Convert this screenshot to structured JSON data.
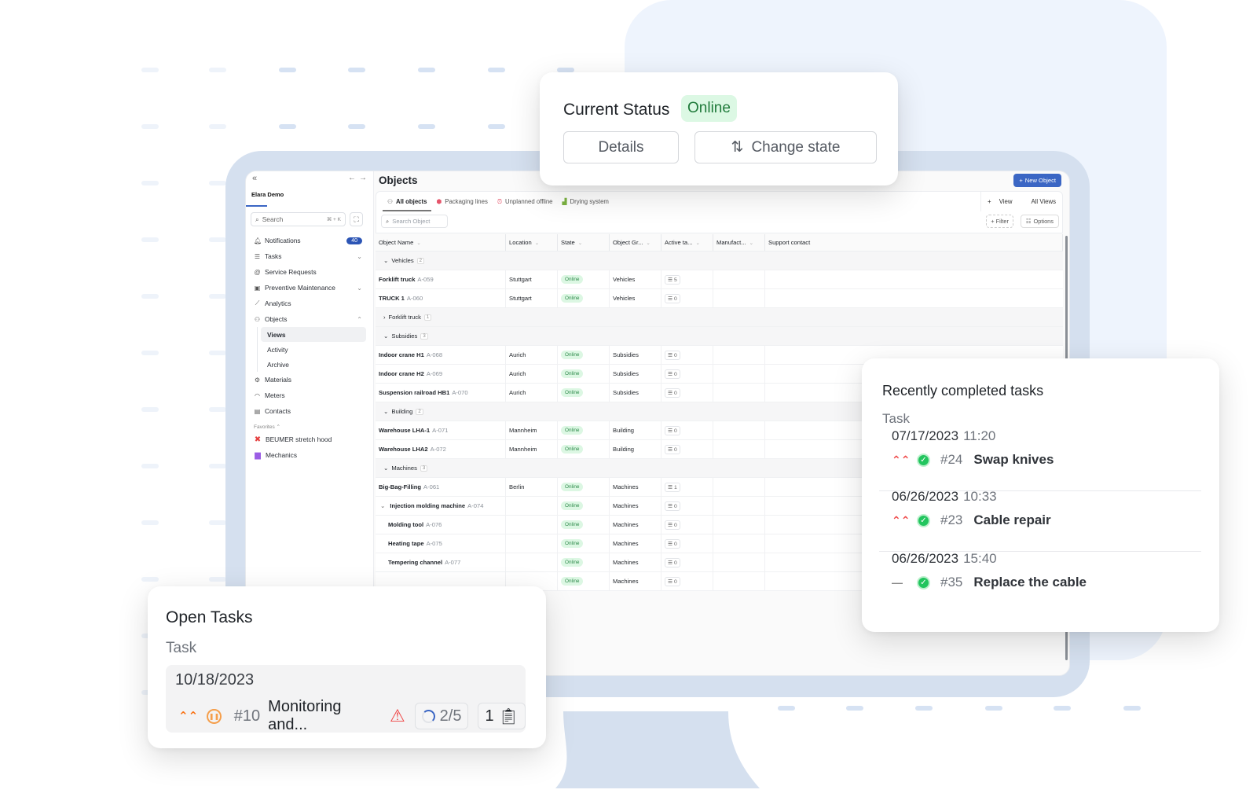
{
  "sidebar": {
    "workspace": "Elara Demo",
    "search_placeholder": "Search",
    "search_shortcut": "⌘ + K",
    "items": [
      {
        "label": "Notifications",
        "icon": "bell-icon",
        "badge": "40"
      },
      {
        "label": "Tasks",
        "icon": "tasks-icon"
      },
      {
        "label": "Service Requests",
        "icon": "at-icon"
      },
      {
        "label": "Preventive Maintenance",
        "icon": "calendar-icon"
      },
      {
        "label": "Analytics",
        "icon": "chart-icon"
      },
      {
        "label": "Objects",
        "icon": "objects-icon"
      }
    ],
    "objects_sub": [
      "Views",
      "Activity",
      "Archive"
    ],
    "items_after": [
      {
        "label": "Materials",
        "icon": "gear-icon"
      },
      {
        "label": "Meters",
        "icon": "gauge-icon"
      },
      {
        "label": "Contacts",
        "icon": "contact-icon"
      }
    ],
    "favorites_label": "Favorites",
    "favorites": [
      {
        "label": "BEUMER stretch hood",
        "color": "#e53e3e"
      },
      {
        "label": "Mechanics",
        "color": "#9b5de5"
      }
    ]
  },
  "main": {
    "title": "Objects",
    "new_button": "New Object",
    "tabs": [
      {
        "label": "All objects",
        "active": true
      },
      {
        "label": "Packaging lines"
      },
      {
        "label": "Unplanned offline"
      },
      {
        "label": "Drying system"
      }
    ],
    "add_view": "View",
    "all_views": "All Views",
    "search_placeholder": "Search Object",
    "filter": "Filter",
    "options": "Options",
    "columns": [
      "Object Name",
      "Location",
      "State",
      "Object Gr...",
      "Active ta...",
      "Manufact...",
      "Support contact"
    ],
    "rows": [
      {
        "type": "group",
        "label": "Vehicles",
        "count": "2",
        "expanded": true
      },
      {
        "type": "item",
        "name": "Forklift truck",
        "code": "A-059",
        "location": "Stuttgart",
        "state": "Online",
        "group": "Vehicles",
        "tasks": "5"
      },
      {
        "type": "item",
        "name": "TRUCK 1",
        "code": "A-060",
        "location": "Stuttgart",
        "state": "Online",
        "group": "Vehicles",
        "tasks": "0"
      },
      {
        "type": "group",
        "label": "Forklift truck",
        "count": "1",
        "expanded": false
      },
      {
        "type": "group",
        "label": "Subsidies",
        "count": "3",
        "expanded": true
      },
      {
        "type": "item",
        "name": "Indoor crane H1",
        "code": "A-068",
        "location": "Aurich",
        "state": "Online",
        "group": "Subsidies",
        "tasks": "0"
      },
      {
        "type": "item",
        "name": "Indoor crane H2",
        "code": "A-069",
        "location": "Aurich",
        "state": "Online",
        "group": "Subsidies",
        "tasks": "0"
      },
      {
        "type": "item",
        "name": "Suspension railroad HB1",
        "code": "A-070",
        "location": "Aurich",
        "state": "Online",
        "group": "Subsidies",
        "tasks": "0"
      },
      {
        "type": "group",
        "label": "Building",
        "count": "2",
        "expanded": true
      },
      {
        "type": "item",
        "name": "Warehouse LHA-1",
        "code": "A-071",
        "location": "Mannheim",
        "state": "Online",
        "group": "Building",
        "tasks": "0"
      },
      {
        "type": "item",
        "name": "Warehouse LHA2",
        "code": "A-072",
        "location": "Mannheim",
        "state": "Online",
        "group": "Building",
        "tasks": "0"
      },
      {
        "type": "group",
        "label": "Machines",
        "count": "3",
        "expanded": true
      },
      {
        "type": "item",
        "name": "Big-Bag-Filling",
        "code": "A-061",
        "location": "Berlin",
        "state": "Online",
        "group": "Machines",
        "tasks": "1"
      },
      {
        "type": "parent",
        "name": "Injection molding machine",
        "code": "A-074",
        "location": "",
        "state": "Online",
        "group": "Machines",
        "tasks": "0"
      },
      {
        "type": "child",
        "name": "Molding tool",
        "code": "A-076",
        "location": "",
        "state": "Online",
        "group": "Machines",
        "tasks": "0"
      },
      {
        "type": "child",
        "name": "Heating tape",
        "code": "A-075",
        "location": "",
        "state": "Online",
        "group": "Machines",
        "tasks": "0"
      },
      {
        "type": "child",
        "name": "Tempering channel",
        "code": "A-077",
        "location": "",
        "state": "Online",
        "group": "Machines",
        "tasks": "0"
      },
      {
        "type": "child",
        "name": "",
        "code": "",
        "location": "",
        "state": "Online",
        "group": "Machines",
        "tasks": "0"
      }
    ]
  },
  "status_card": {
    "title": "Current Status",
    "status": "Online",
    "details_button": "Details",
    "change_button": "Change state"
  },
  "recent_card": {
    "title": "Recently completed tasks",
    "subtitle": "Task",
    "items": [
      {
        "date": "07/17/2023",
        "time": "11:20",
        "priority": "high",
        "number": "#24",
        "name": "Swap knives"
      },
      {
        "date": "06/26/2023",
        "time": "10:33",
        "priority": "high",
        "number": "#23",
        "name": "Cable repair"
      },
      {
        "date": "06/26/2023",
        "time": "15:40",
        "priority": "none",
        "number": "#35",
        "name": "Replace the cable"
      }
    ]
  },
  "open_card": {
    "title": "Open Tasks",
    "subtitle": "Task",
    "task": {
      "date": "10/18/2023",
      "number": "#10",
      "name": "Monitoring and...",
      "progress": "2/5",
      "checklist_count": "1"
    }
  },
  "colors": {
    "accent": "#3b66c4",
    "online_bg": "#dcf8e4",
    "online_text": "#1f7a3a",
    "priority_high": "#ef4444",
    "priority_medium": "#f97316"
  }
}
